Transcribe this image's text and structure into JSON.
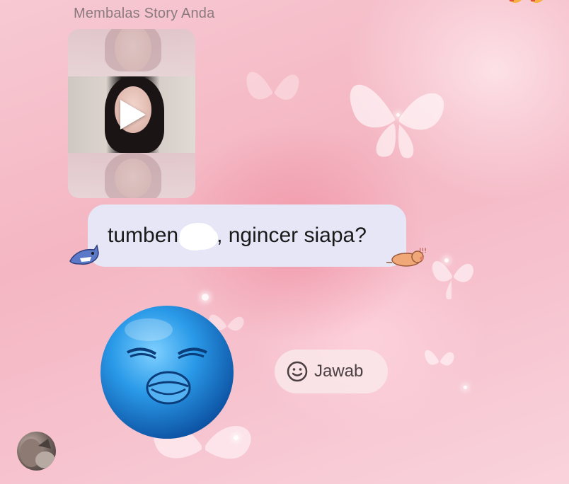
{
  "story_reply": {
    "label": "Membalas Story Anda",
    "media": {
      "type": "video",
      "icon": "play-icon"
    }
  },
  "message": {
    "text_before": "tumben",
    "text_after": ", ngincer siapa?",
    "bubble_color": "#e7e6f7",
    "redacted_word": true
  },
  "stickers": {
    "left": "shark-sticker",
    "right": "pig-sticker",
    "large": "blue-kissing-face-sticker"
  },
  "reply_button": {
    "label": "Jawab",
    "icon": "smiley-icon"
  },
  "sender": {
    "avatar": "avatar"
  },
  "colors": {
    "background": "#f4b6c2",
    "text_dark": "#1a1a1a",
    "label_gray": "#8a7a80"
  }
}
